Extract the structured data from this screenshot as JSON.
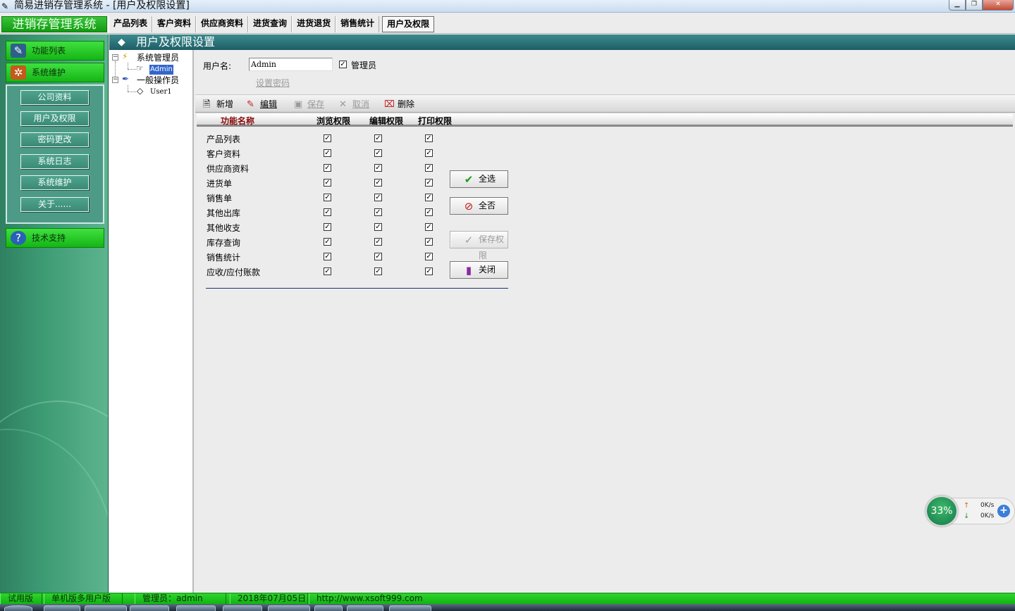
{
  "window": {
    "title": "简易进销存管理系统 - [用户及权限设置]",
    "buttons": [
      "▁",
      "❐",
      "✕"
    ]
  },
  "header": {
    "brand": "进销存管理系统",
    "menu": [
      "产品列表",
      "客户资料",
      "供应商资料",
      "进货查询",
      "进货退货",
      "销售统计",
      "用户及权限"
    ],
    "active_menu": "用户及权限"
  },
  "sidebar": {
    "sections": {
      "functions": "功能列表",
      "maintenance": "系统维护",
      "support": "技术支持"
    },
    "items": [
      "公司资料",
      "用户及权限",
      "密码更改",
      "系统日志",
      "系统维护",
      "关于......"
    ]
  },
  "panel": {
    "title": "用户及权限设置"
  },
  "tree": {
    "groups": [
      {
        "label": "系统管理员",
        "children": [
          "Admin"
        ]
      },
      {
        "label": "一般操作员",
        "children": [
          "User1"
        ]
      }
    ],
    "selected": "Admin"
  },
  "user_form": {
    "username_label": "用户名:",
    "username_value": "Admin",
    "admin_label": "管理员",
    "admin_checked": true,
    "set_password": "设置密码"
  },
  "toolbar": {
    "new": "新增",
    "edit": "编辑",
    "save": "保存",
    "cancel": "取消",
    "delete": "删除"
  },
  "permissions": {
    "columns": [
      "功能名称",
      "浏览权限",
      "编辑权限",
      "打印权限"
    ],
    "rows": [
      {
        "name": "产品列表",
        "browse": true,
        "edit": true,
        "print": true
      },
      {
        "name": "客户资料",
        "browse": true,
        "edit": true,
        "print": true
      },
      {
        "name": "供应商资料",
        "browse": true,
        "edit": true,
        "print": true
      },
      {
        "name": "进货单",
        "browse": true,
        "edit": true,
        "print": true
      },
      {
        "name": "销售单",
        "browse": true,
        "edit": true,
        "print": true
      },
      {
        "name": "其他出库",
        "browse": true,
        "edit": true,
        "print": true
      },
      {
        "name": "其他收支",
        "browse": true,
        "edit": true,
        "print": true
      },
      {
        "name": "库存查询",
        "browse": true,
        "edit": true,
        "print": true
      },
      {
        "name": "销售统计",
        "browse": true,
        "edit": true,
        "print": true
      },
      {
        "name": "应收/应付账款",
        "browse": true,
        "edit": true,
        "print": true
      }
    ]
  },
  "actions": {
    "select_all": "全选",
    "select_none": "全否",
    "save_permissions": "保存权限",
    "close": "关闭"
  },
  "net_widget": {
    "percent": "33%",
    "up": "0K/s",
    "down": "0K/s"
  },
  "status_bar": {
    "edition": "试用版",
    "mode": "单机版多用户版",
    "operator": "管理员：admin",
    "date": "2018年07月05日",
    "url": "http://www.xsoft999.com"
  },
  "colors": {
    "brand_green": "#129a12",
    "panel_teal": "#1e5e66",
    "header_red": "#8a0b0b",
    "selection_blue": "#3366cc"
  }
}
